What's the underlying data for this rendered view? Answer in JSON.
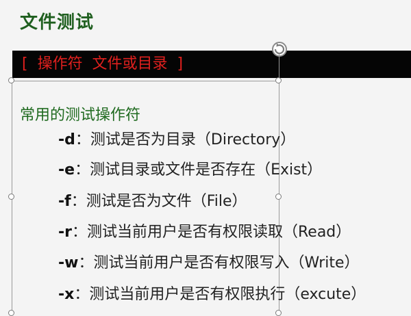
{
  "slide": {
    "title": "文件测试",
    "bar_text": "[  操作符  文件或目录  ]",
    "section_heading": "常用的测试操作符",
    "items": [
      {
        "flag": "-d",
        "desc": "：测试是否为目录（Directory）"
      },
      {
        "flag": "-e",
        "desc": "：测试目录或文件是否存在（Exist）"
      },
      {
        "flag": "-f",
        "desc": "：测试是否为文件（File）"
      },
      {
        "flag": "-r",
        "desc": "：测试当前用户是否有权限读取（Read）"
      },
      {
        "flag": "-w",
        "desc": "：测试当前用户是否有权限写入（Write）"
      },
      {
        "flag": "-x",
        "desc": "：测试当前用户是否有权限执行（excute）"
      }
    ]
  },
  "colors": {
    "title": "#1f5f1f",
    "bar_background": "#050505",
    "bar_text": "#e0201e",
    "heading": "#1f6a1f",
    "body_text": "#222222",
    "background": "#f4f4f4"
  },
  "icons": {
    "rotate_handle": "rotate-icon",
    "resize_handle": "resize-handle-icon"
  }
}
